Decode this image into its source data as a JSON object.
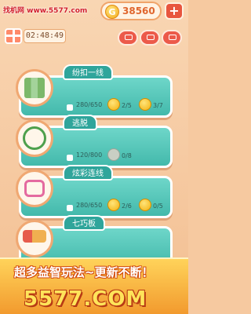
{
  "watermark": "找机网 www.5577.com",
  "coins": {
    "value": "38560",
    "icon": "coin-G-icon",
    "icon_letter": "G"
  },
  "timer": "02:48:49",
  "levels": [
    {
      "name": "纷扣一线",
      "progress": "280/650",
      "medal_a": "2/5",
      "medal_b": "3/7"
    },
    {
      "name": "逃脱",
      "progress": "120/800",
      "medal_a": "0/8"
    },
    {
      "name": "炫彩连线",
      "progress": "280/650",
      "medal_a": "2/6",
      "medal_b": "0/5"
    },
    {
      "name": "七巧板"
    }
  ],
  "banner": {
    "line1": "超多益智玩法~更新不断！",
    "line2": "5577.COM"
  },
  "colors": {
    "accent": "#43b9ab",
    "brand": "#e8553e"
  }
}
